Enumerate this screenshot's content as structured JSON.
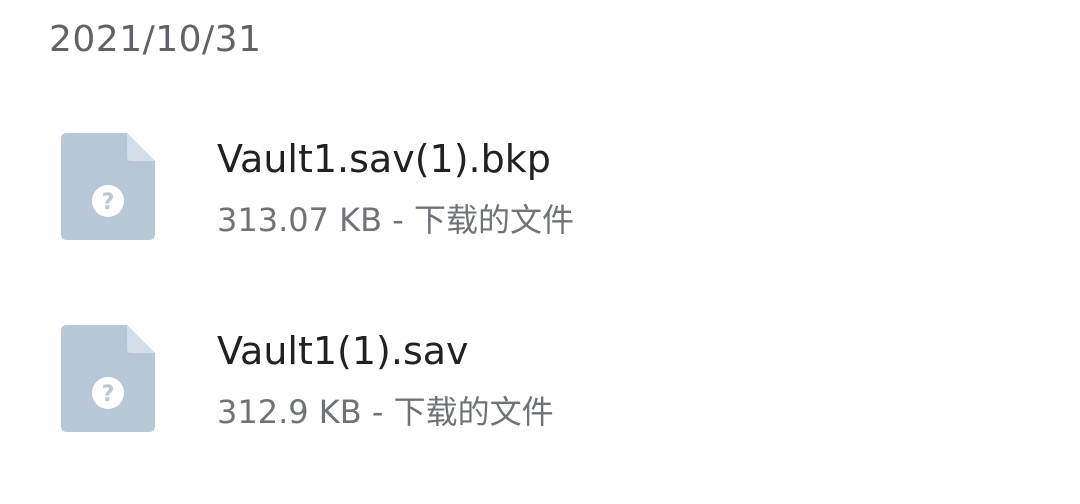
{
  "group": {
    "date": "2021/10/31"
  },
  "files": [
    {
      "name": "Vault1.sav(1).bkp",
      "size": "313.07 KB",
      "separator": "-",
      "source": "下载的文件",
      "icon": "unknown-file-icon"
    },
    {
      "name": "Vault1(1).sav",
      "size": "312.9 KB",
      "separator": "-",
      "source": "下载的文件",
      "icon": "unknown-file-icon"
    }
  ],
  "colors": {
    "icon_body": "#b9c8d7",
    "icon_fold": "#d3dde7",
    "icon_badge": "#ffffff",
    "icon_glyph": "#b9c8d7"
  }
}
